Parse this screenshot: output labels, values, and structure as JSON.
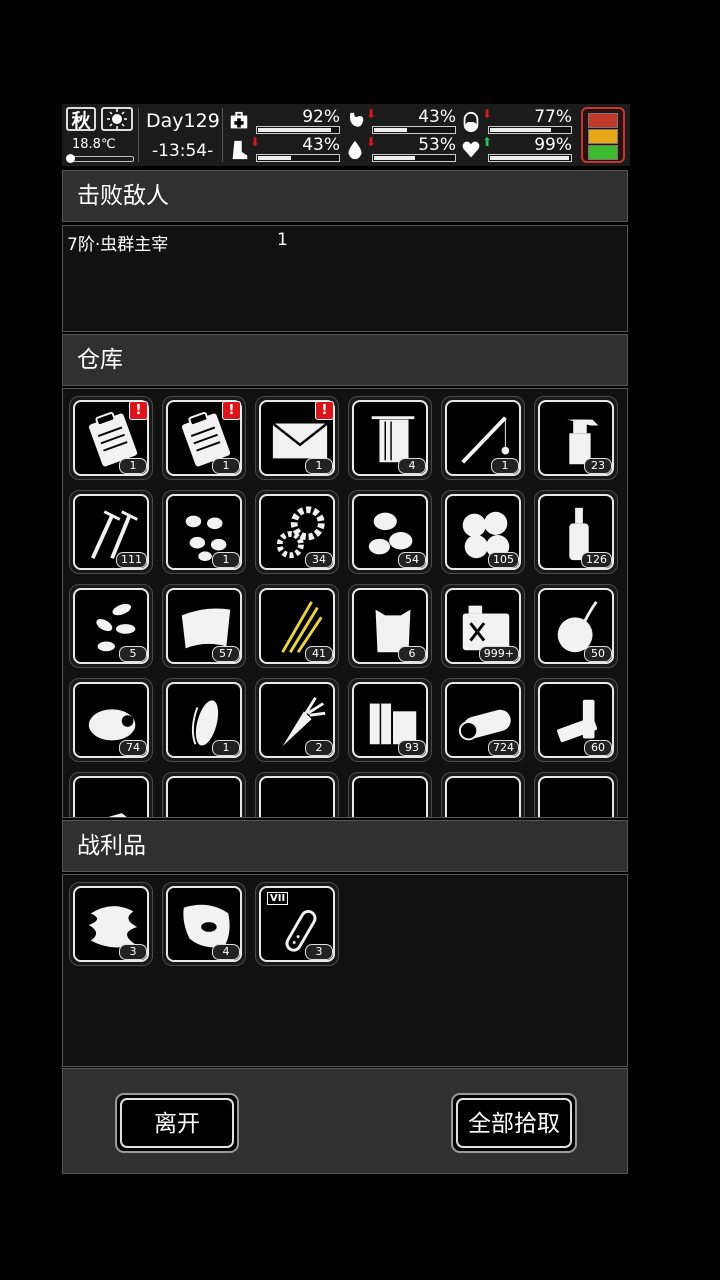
{
  "status": {
    "season": "秋",
    "weather_icon": "sun-icon",
    "temperature": "18.8℃",
    "day": "Day129",
    "time": "-13:54-",
    "stats": [
      {
        "name": "health",
        "icon": "medkit-icon",
        "value": "92%",
        "level": 0.92,
        "arrow": ""
      },
      {
        "name": "hunger",
        "icon": "stomach-icon",
        "value": "43%",
        "level": 0.43,
        "arrow": "down"
      },
      {
        "name": "sanity",
        "icon": "pill-icon",
        "value": "77%",
        "level": 0.77,
        "arrow": "down"
      },
      {
        "name": "stamina",
        "icon": "boot-icon",
        "value": "43%",
        "level": 0.43,
        "arrow": "down"
      },
      {
        "name": "thirst",
        "icon": "water-drop-icon",
        "value": "53%",
        "level": 0.53,
        "arrow": "down"
      },
      {
        "name": "mood",
        "icon": "heart-icon",
        "value": "99%",
        "level": 0.99,
        "arrow": "up"
      }
    ],
    "arrow_colors": {
      "down": "#e0141c",
      "up": "#22c55e"
    },
    "battery_colors": [
      "#c0392b",
      "#e6a817",
      "#3dbb2e"
    ]
  },
  "defeated": {
    "title": "击败敌人",
    "enemy_name": "7阶·虫群主宰",
    "enemy_count": "1"
  },
  "warehouse": {
    "title": "仓库",
    "items": [
      {
        "icon": "clipboard-icon",
        "count": "1",
        "alert": "!"
      },
      {
        "icon": "clipboard-icon",
        "count": "1",
        "alert": "!"
      },
      {
        "icon": "envelope-icon",
        "count": "1",
        "alert": "!"
      },
      {
        "icon": "towel-icon",
        "count": "4"
      },
      {
        "icon": "fishing-rod-icon",
        "count": "1"
      },
      {
        "icon": "spray-bottle-icon",
        "count": "23"
      },
      {
        "icon": "nails-icon",
        "count": "111"
      },
      {
        "icon": "seeds-icon",
        "count": "1"
      },
      {
        "icon": "gears-icon",
        "count": "34"
      },
      {
        "icon": "beans-icon",
        "count": "54"
      },
      {
        "icon": "cotton-icon",
        "count": "105"
      },
      {
        "icon": "water-bottle-icon",
        "count": "126"
      },
      {
        "icon": "sunflower-seeds-icon",
        "count": "5"
      },
      {
        "icon": "cloth-icon",
        "count": "57"
      },
      {
        "icon": "straw-icon",
        "count": "41"
      },
      {
        "icon": "sack-icon",
        "count": "6"
      },
      {
        "icon": "fuel-can-icon",
        "count": "999+"
      },
      {
        "icon": "onion-icon",
        "count": "50"
      },
      {
        "icon": "meat-icon",
        "count": "74"
      },
      {
        "icon": "corn-icon",
        "count": "1"
      },
      {
        "icon": "carrot-icon",
        "count": "2"
      },
      {
        "icon": "planks-icon",
        "count": "93"
      },
      {
        "icon": "log-icon",
        "count": "724"
      },
      {
        "icon": "battery-icon",
        "count": "60"
      },
      {
        "icon": "paper-icon",
        "count": ""
      },
      {
        "icon": "bullets-icon",
        "count": ""
      },
      {
        "icon": "pot-icon",
        "count": ""
      },
      {
        "icon": "pills-icon",
        "count": ""
      },
      {
        "icon": "fan-icon",
        "count": ""
      },
      {
        "icon": "bullet-icon",
        "count": ""
      }
    ]
  },
  "loot": {
    "title": "战利品",
    "items": [
      {
        "icon": "fur-icon",
        "count": "3"
      },
      {
        "icon": "raw-meat-icon",
        "count": "4"
      },
      {
        "icon": "test-tube-icon",
        "count": "3",
        "label": "VII"
      }
    ]
  },
  "footer": {
    "leave_label": "离开",
    "pickup_all_label": "全部拾取"
  }
}
